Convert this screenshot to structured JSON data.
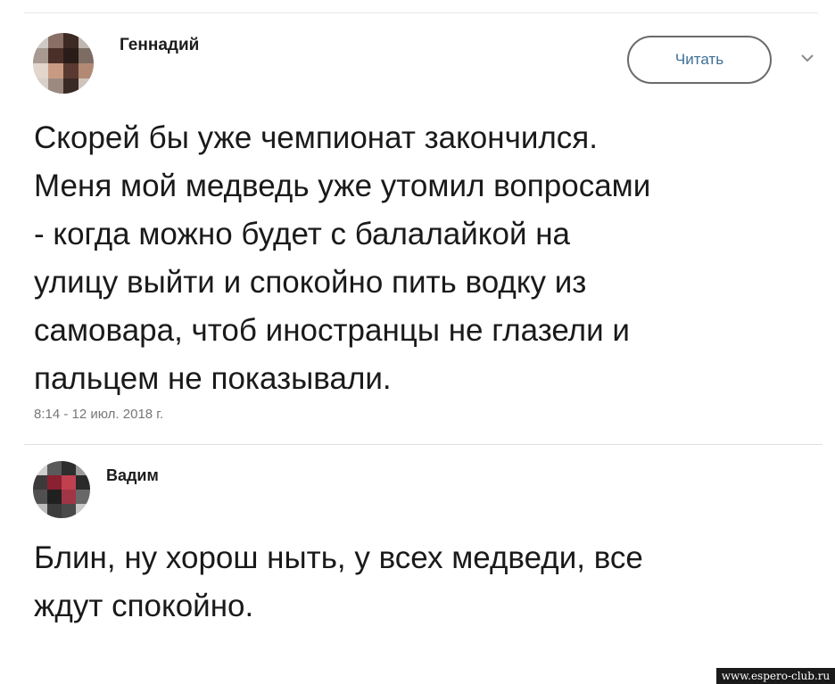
{
  "tweet": {
    "author": "Геннадий",
    "follow_label": "Читать",
    "text": "Скорей бы уже чемпионат закончился.\nМеня мой медведь уже утомил вопросами\n- когда можно будет с балалайкой на\nулицу выйти  и спокойно пить водку из\nсамовара, чтоб иностранцы не глазели и\nпальцем не показывали.",
    "timestamp": "8:14 - 12 июл. 2018 г."
  },
  "reply": {
    "author": "Вадим",
    "text": "Блин, ну хорош ныть, у всех медведи, все\nждут спокойно."
  },
  "watermark": "www.espero-club.ru",
  "colors": {
    "follow_text": "#3d6f96",
    "text": "#1a1a1a",
    "timestamp": "#777777"
  },
  "icons": {
    "menu": "chevron-down-icon",
    "avatar": "pixelated-avatar"
  }
}
